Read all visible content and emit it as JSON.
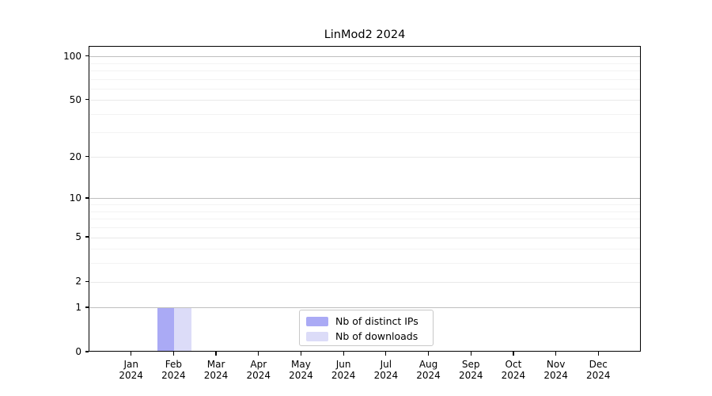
{
  "chart_data": {
    "type": "bar",
    "title": "LinMod2 2024",
    "categories": [
      "Jan 2024",
      "Feb 2024",
      "Mar 2024",
      "Apr 2024",
      "May 2024",
      "Jun 2024",
      "Jul 2024",
      "Aug 2024",
      "Sep 2024",
      "Oct 2024",
      "Nov 2024",
      "Dec 2024"
    ],
    "series": [
      {
        "name": "Nb of distinct IPs",
        "color": "#aaaaf5",
        "values": [
          0,
          1,
          0,
          0,
          0,
          0,
          0,
          0,
          0,
          0,
          0,
          0
        ]
      },
      {
        "name": "Nb of downloads",
        "color": "#dcdcf8",
        "values": [
          0,
          1,
          0,
          0,
          0,
          0,
          0,
          0,
          0,
          0,
          0,
          0
        ]
      }
    ],
    "y_scale": "log1p",
    "ylim": [
      0,
      117
    ],
    "y_major_ticks": [
      0,
      1,
      2,
      5,
      10,
      20,
      50,
      100
    ],
    "y_gridlines": {
      "decade": [
        1,
        10,
        100
      ],
      "mid": [
        2,
        5,
        20,
        50
      ],
      "minor": [
        3,
        4,
        6,
        7,
        8,
        9,
        30,
        40,
        60,
        70,
        80,
        90
      ]
    },
    "grid_colors": {
      "decade": "#bfbfbf",
      "mid": "#e9e9e9",
      "minor": "#f3f3f3"
    },
    "axis_color": "#000000",
    "legend_position": "lower center inside",
    "legend_border_color": "#c8c8c8"
  }
}
